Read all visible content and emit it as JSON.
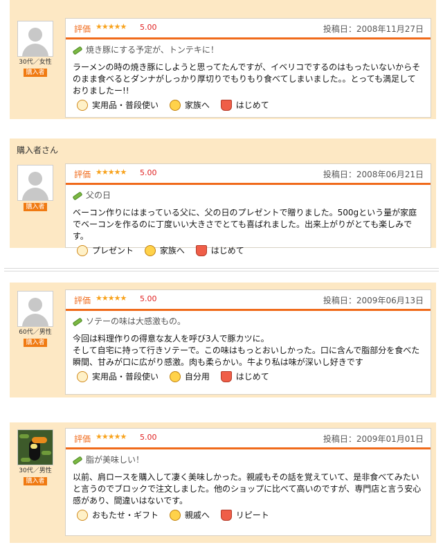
{
  "reviews": [
    {
      "reviewer_name": "",
      "user_info": "30代／女性",
      "badge": "購入者",
      "rating_label": "評価",
      "stars": "★★★★★",
      "score": "5.00",
      "date": "投稿日：2008年11月27日",
      "title": "焼き豚にする予定が、トンテキに！",
      "body": "ラーメンの時の焼き豚にしようと思ってたんですが、イベリコでするのはもったいないからそのまま食べるとダンナがしっかり厚切りでもりもり食べてしまいました。。とっても満足しておりましたー!!",
      "tags": [
        "実用品・普段使い",
        "家族へ",
        "はじめて"
      ]
    },
    {
      "reviewer_name": "購入者さん",
      "user_info": "",
      "badge": "購入者",
      "rating_label": "評価",
      "stars": "★★★★★",
      "score": "5.00",
      "date": "投稿日：2008年06月21日",
      "title": "父の日",
      "body": "ベーコン作りにはまっている父に、父の日のプレゼントで贈りました。500gという量が家庭でベーコンを作るのに丁度いい大きさでとても喜ばれました。出来上がりがとても楽しみです。",
      "tags": [
        "プレゼント",
        "家族へ",
        "はじめて"
      ]
    },
    {
      "reviewer_name": "",
      "user_info": "60代／男性",
      "badge": "購入者",
      "rating_label": "評価",
      "stars": "★★★★★",
      "score": "5.00",
      "date": "投稿日：2009年06月13日",
      "title": "ソテーの味は大感激もの。",
      "body": "今回は料理作りの得意な友人を呼び3人で豚カツに。\nそして自宅に持って行きソテーで。この味はもっとおいしかった。口に含んで脂部分を食べた瞬間、甘みが口に広がり感激。肉も柔らかい。牛より私は味が深いし好きです",
      "tags": [
        "実用品・普段使い",
        "自分用",
        "はじめて"
      ]
    },
    {
      "reviewer_name": "",
      "user_info": "30代／男性",
      "badge": "購入者",
      "rating_label": "評価",
      "stars": "★★★★★",
      "score": "5.00",
      "date": "投稿日：2009年01月01日",
      "title": "脂が美味しい！",
      "body": "以前、肩ロースを購入して凄く美味しかった。親戚もその話を覚えていて、是非食べてみたいと言うのでブロックで注文しました。他のショップに比べて高いのですが、専門店と言う安心感があり、間違いはないです。",
      "tags": [
        "おもたせ・ギフト",
        "親戚へ",
        "リピート"
      ]
    }
  ],
  "colors": {
    "panel_bg": "#fde8c4",
    "accent_orange": "#f06a1a",
    "star_color": "#f8a21c",
    "score_red": "#e02020",
    "badge_bg": "#f07a12"
  },
  "icons": [
    "avatar-placeholder-icon",
    "toucan-avatar-photo",
    "pencil-icon",
    "hand-icon",
    "family-icon",
    "basket-icon"
  ]
}
